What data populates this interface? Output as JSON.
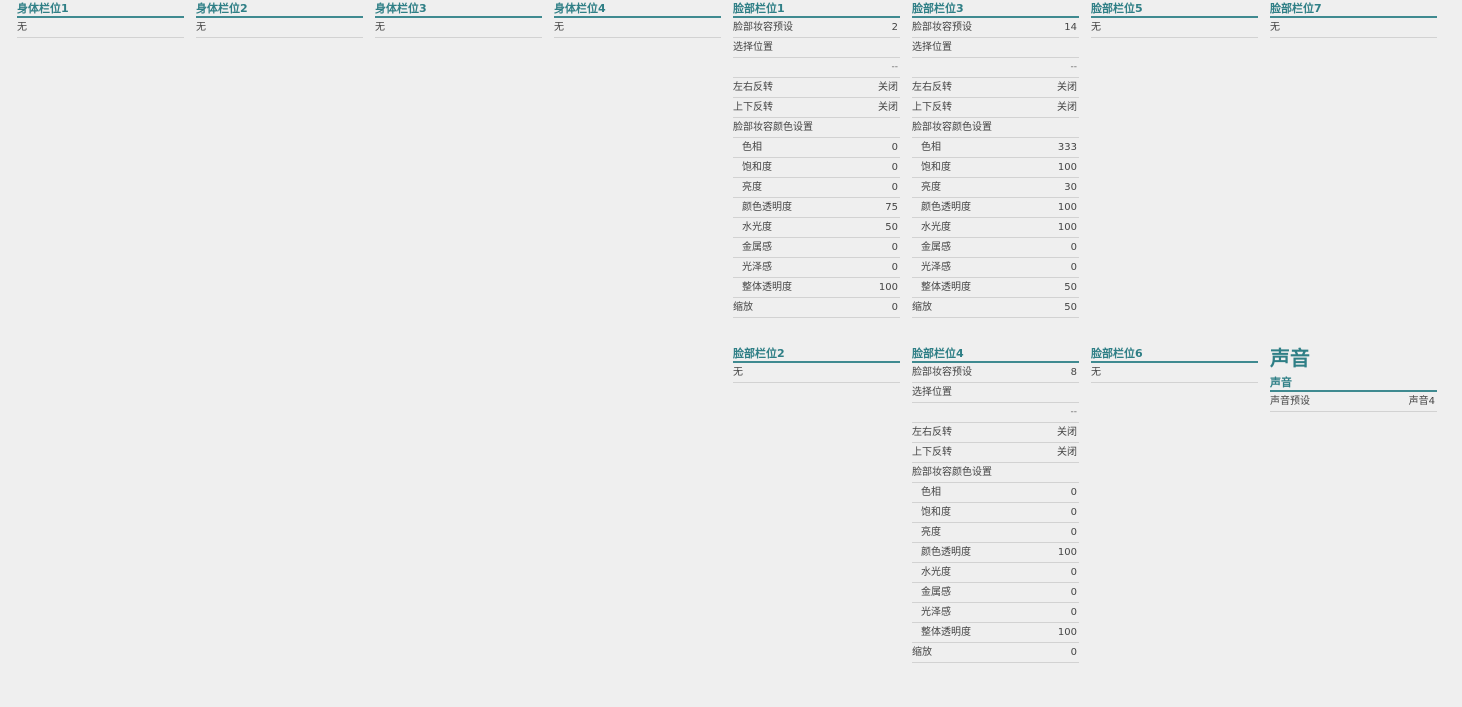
{
  "body_slots": [
    {
      "title": "身体栏位1",
      "value": "无"
    },
    {
      "title": "身体栏位2",
      "value": "无"
    },
    {
      "title": "身体栏位3",
      "value": "无"
    },
    {
      "title": "身体栏位4",
      "value": "无"
    }
  ],
  "face1": {
    "title": "脸部栏位1",
    "rows": [
      {
        "label": "脸部妆容预设",
        "value": "2"
      },
      {
        "label": "选择位置",
        "value": ""
      },
      {
        "label": "",
        "value": "--"
      },
      {
        "label": "左右反转",
        "value": "关闭"
      },
      {
        "label": "上下反转",
        "value": "关闭"
      },
      {
        "label": "脸部妆容颜色设置",
        "value": ""
      },
      {
        "label": "色相",
        "value": "0"
      },
      {
        "label": "饱和度",
        "value": "0"
      },
      {
        "label": "亮度",
        "value": "0"
      },
      {
        "label": "颜色透明度",
        "value": "75"
      },
      {
        "label": "水光度",
        "value": "50"
      },
      {
        "label": "金属感",
        "value": "0"
      },
      {
        "label": "光泽感",
        "value": "0"
      },
      {
        "label": "整体透明度",
        "value": "100"
      },
      {
        "label": "缩放",
        "value": "0"
      }
    ]
  },
  "face3": {
    "title": "脸部栏位3",
    "rows": [
      {
        "label": "脸部妆容预设",
        "value": "14"
      },
      {
        "label": "选择位置",
        "value": ""
      },
      {
        "label": "",
        "value": "--"
      },
      {
        "label": "左右反转",
        "value": "关闭"
      },
      {
        "label": "上下反转",
        "value": "关闭"
      },
      {
        "label": "脸部妆容颜色设置",
        "value": ""
      },
      {
        "label": "色相",
        "value": "333"
      },
      {
        "label": "饱和度",
        "value": "100"
      },
      {
        "label": "亮度",
        "value": "30"
      },
      {
        "label": "颜色透明度",
        "value": "100"
      },
      {
        "label": "水光度",
        "value": "100"
      },
      {
        "label": "金属感",
        "value": "0"
      },
      {
        "label": "光泽感",
        "value": "0"
      },
      {
        "label": "整体透明度",
        "value": "50"
      },
      {
        "label": "缩放",
        "value": "50"
      }
    ]
  },
  "face5": {
    "title": "脸部栏位5",
    "value": "无"
  },
  "face7": {
    "title": "脸部栏位7",
    "value": "无"
  },
  "face2": {
    "title": "脸部栏位2",
    "value": "无"
  },
  "face4": {
    "title": "脸部栏位4",
    "rows": [
      {
        "label": "脸部妆容预设",
        "value": "8"
      },
      {
        "label": "选择位置",
        "value": ""
      },
      {
        "label": "",
        "value": "--"
      },
      {
        "label": "左右反转",
        "value": "关闭"
      },
      {
        "label": "上下反转",
        "value": "关闭"
      },
      {
        "label": "脸部妆容颜色设置",
        "value": ""
      },
      {
        "label": "色相",
        "value": "0"
      },
      {
        "label": "饱和度",
        "value": "0"
      },
      {
        "label": "亮度",
        "value": "0"
      },
      {
        "label": "颜色透明度",
        "value": "100"
      },
      {
        "label": "水光度",
        "value": "0"
      },
      {
        "label": "金属感",
        "value": "0"
      },
      {
        "label": "光泽感",
        "value": "0"
      },
      {
        "label": "整体透明度",
        "value": "100"
      },
      {
        "label": "缩放",
        "value": "0"
      }
    ]
  },
  "face6": {
    "title": "脸部栏位6",
    "value": "无"
  },
  "sound": {
    "heading": "声音",
    "section_title": "声音",
    "preset_label": "声音预设",
    "preset_value": "声音4"
  },
  "colors": {
    "accent": "#3f8a90",
    "title_text": "#2f7f86",
    "background": "#efefef"
  }
}
